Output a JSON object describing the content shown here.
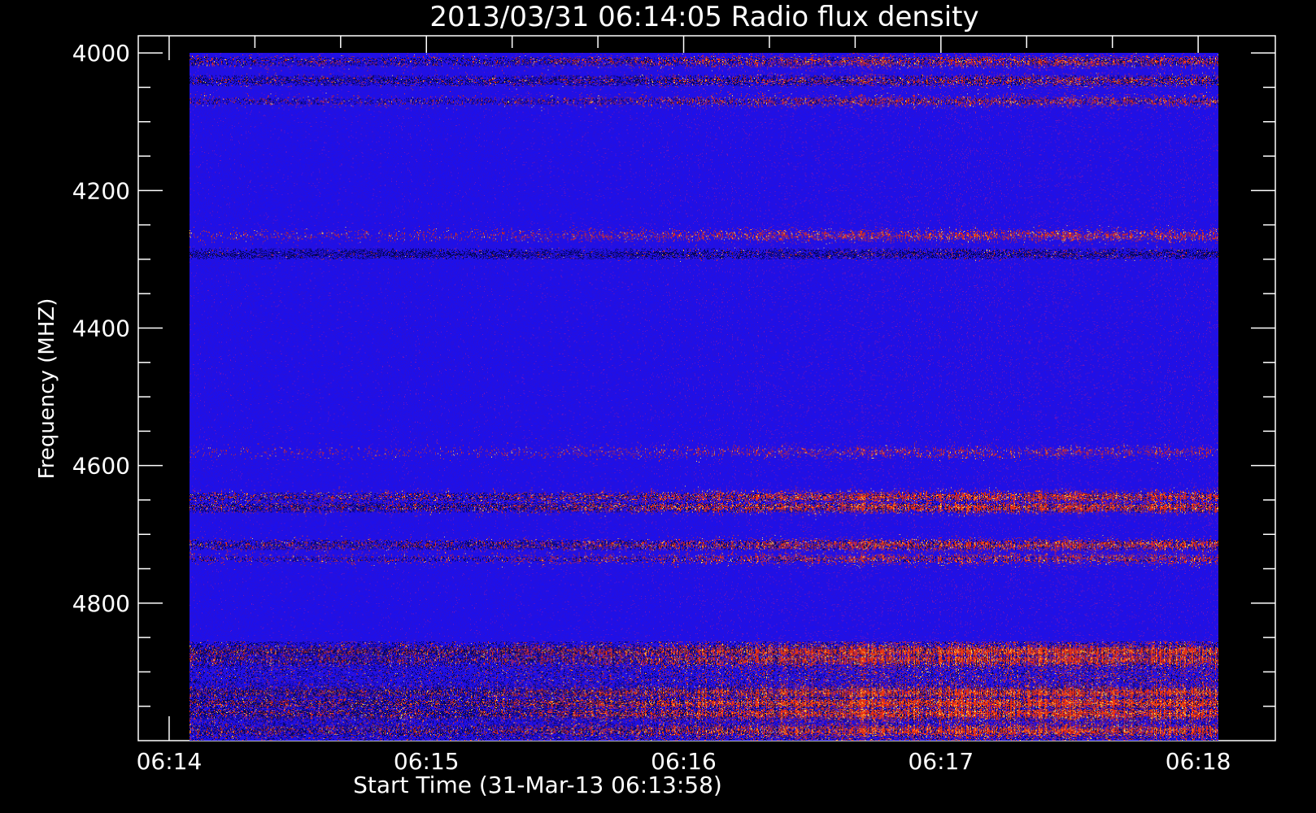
{
  "chart_data": {
    "type": "heatmap",
    "title": "2013/03/31 06:14:05 Radio flux density",
    "xlabel": "Start Time (31-Mar-13 06:13:58)",
    "ylabel": "Frequency (MHZ)",
    "x_tick_labels": [
      "06:14",
      "06:15",
      "06:16",
      "06:17",
      "06:18"
    ],
    "x_tick_minutes": [
      0,
      1,
      2,
      3,
      4
    ],
    "y_tick_labels": [
      "4000",
      "4200",
      "4400",
      "4600",
      "4800"
    ],
    "y_tick_values": [
      4000,
      4200,
      4400,
      4600,
      4800
    ],
    "ylim": [
      3975,
      5000
    ],
    "xlim_minutes": [
      -0.12,
      4.3
    ],
    "data_x_range_minutes": [
      0.08,
      4.08
    ],
    "data_y_range": [
      4000,
      5000
    ],
    "y_axis_inverted": true,
    "colors": {
      "background": "#000000",
      "axes": "#ffffff",
      "base": "#1a10f0",
      "dark_band": "#05054a",
      "burst": "#ff3010",
      "peak": "#ffe050"
    },
    "bands": [
      {
        "freq": 4012,
        "strength": 0.55,
        "dark": 0.7
      },
      {
        "freq": 4040,
        "strength": 0.4,
        "dark": 0.9
      },
      {
        "freq": 4070,
        "strength": 0.45,
        "dark": 0.5
      },
      {
        "freq": 4265,
        "strength": 0.55,
        "dark": 0.3
      },
      {
        "freq": 4292,
        "strength": 0.1,
        "dark": 1.0
      },
      {
        "freq": 4580,
        "strength": 0.35,
        "dark": 0.3
      },
      {
        "freq": 4645,
        "strength": 0.8,
        "dark": 0.7
      },
      {
        "freq": 4660,
        "strength": 0.8,
        "dark": 0.9
      },
      {
        "freq": 4715,
        "strength": 0.7,
        "dark": 0.8
      },
      {
        "freq": 4735,
        "strength": 0.5,
        "dark": 0.4
      },
      {
        "freq": 4870,
        "strength": 0.85,
        "dark": 0.9
      },
      {
        "freq": 4882,
        "strength": 0.7,
        "dark": 0.6
      },
      {
        "freq": 4930,
        "strength": 0.75,
        "dark": 0.8
      },
      {
        "freq": 4945,
        "strength": 0.95,
        "dark": 0.9
      },
      {
        "freq": 4960,
        "strength": 0.8,
        "dark": 0.8
      },
      {
        "freq": 4985,
        "strength": 0.7,
        "dark": 0.6
      }
    ]
  }
}
